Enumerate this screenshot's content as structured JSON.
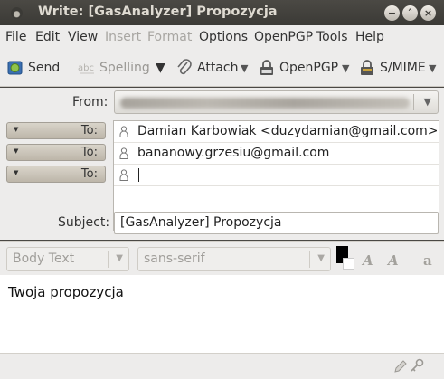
{
  "window": {
    "title": "Write: [GasAnalyzer] Propozycja"
  },
  "menu": [
    {
      "label": "File",
      "enabled": true
    },
    {
      "label": "Edit",
      "enabled": true
    },
    {
      "label": "View",
      "enabled": true
    },
    {
      "label": "Insert",
      "enabled": false
    },
    {
      "label": "Format",
      "enabled": false
    },
    {
      "label": "Options",
      "enabled": true
    },
    {
      "label": "OpenPGP",
      "enabled": true
    },
    {
      "label": "Tools",
      "enabled": true
    },
    {
      "label": "Help",
      "enabled": true
    }
  ],
  "toolbar": {
    "send": "Send",
    "spelling": "Spelling",
    "attach": "Attach",
    "openpgp": "OpenPGP",
    "smime": "S/MIME"
  },
  "header": {
    "from_label": "From:",
    "recipients": [
      {
        "type": "To:",
        "address": "Damian Karbowiak <duzydamian@gmail.com>"
      },
      {
        "type": "To:",
        "address": "bananowy.grzesiu@gmail.com"
      },
      {
        "type": "To:",
        "address": ""
      }
    ],
    "subject_label": "Subject:",
    "subject_value": "[GasAnalyzer] Propozycja"
  },
  "format": {
    "paragraph_style": "Body Text",
    "font_family": "sans-serif"
  },
  "body": {
    "text": "Twoja propozycja"
  },
  "colors": {
    "titlebar": "#3f3e3a",
    "chrome": "#edeceb",
    "text_color_swatch": "#000000"
  }
}
